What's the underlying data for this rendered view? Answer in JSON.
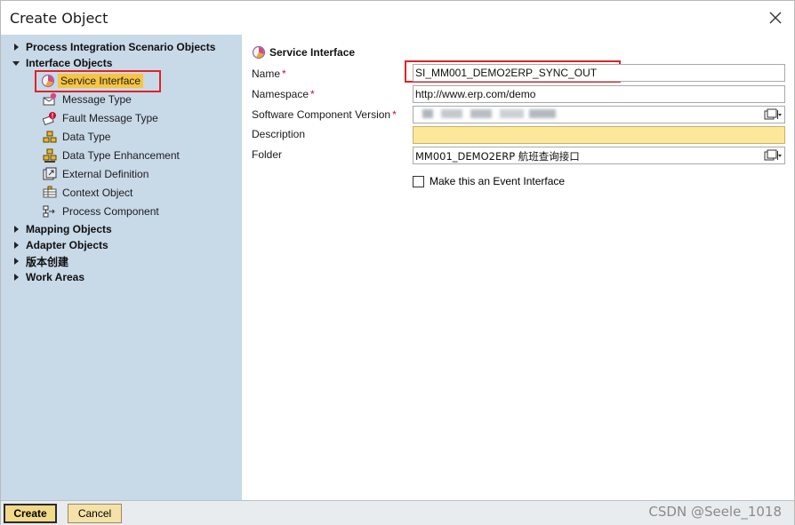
{
  "window": {
    "title": "Create Object"
  },
  "tree": {
    "groups": [
      {
        "label": "Process Integration Scenario Objects",
        "expanded": false
      },
      {
        "label": "Interface Objects",
        "expanded": true
      },
      {
        "label": "Mapping Objects",
        "expanded": false
      },
      {
        "label": "Adapter Objects",
        "expanded": false
      },
      {
        "label": "版本创建",
        "expanded": false
      },
      {
        "label": "Work Areas",
        "expanded": false
      }
    ],
    "interface_items": [
      {
        "label": "Service Interface",
        "icon": "service-interface-icon",
        "selected": true
      },
      {
        "label": "Message Type",
        "icon": "message-type-icon",
        "selected": false
      },
      {
        "label": "Fault Message Type",
        "icon": "fault-message-type-icon",
        "selected": false
      },
      {
        "label": "Data Type",
        "icon": "data-type-icon",
        "selected": false
      },
      {
        "label": "Data Type Enhancement",
        "icon": "data-type-enhancement-icon",
        "selected": false
      },
      {
        "label": "External Definition",
        "icon": "external-definition-icon",
        "selected": false
      },
      {
        "label": "Context Object",
        "icon": "context-object-icon",
        "selected": false
      },
      {
        "label": "Process Component",
        "icon": "process-component-icon",
        "selected": false
      }
    ]
  },
  "form": {
    "header": "Service Interface",
    "name_label": "Name",
    "name_value": "SI_MM001_DEMO2ERP_SYNC_OUT",
    "namespace_label": "Namespace",
    "namespace_value": "http://www.erp.com/demo",
    "swcv_label": "Software Component Version",
    "swcv_value": "",
    "description_label": "Description",
    "description_value": "",
    "folder_label": "Folder",
    "folder_value": "MM001_DEMO2ERP 航班查询接口",
    "event_interface_label": "Make this an Event Interface",
    "event_interface_checked": false,
    "required_marker": "*"
  },
  "buttons": {
    "create": "Create",
    "cancel": "Cancel"
  },
  "watermark": "CSDN @Seele_1018",
  "colors": {
    "tree_bg": "#c8d9e8",
    "selected_bg": "#f6c542",
    "highlight_border": "#e02323",
    "description_bg": "#fde79b",
    "required": "#c8102e"
  }
}
